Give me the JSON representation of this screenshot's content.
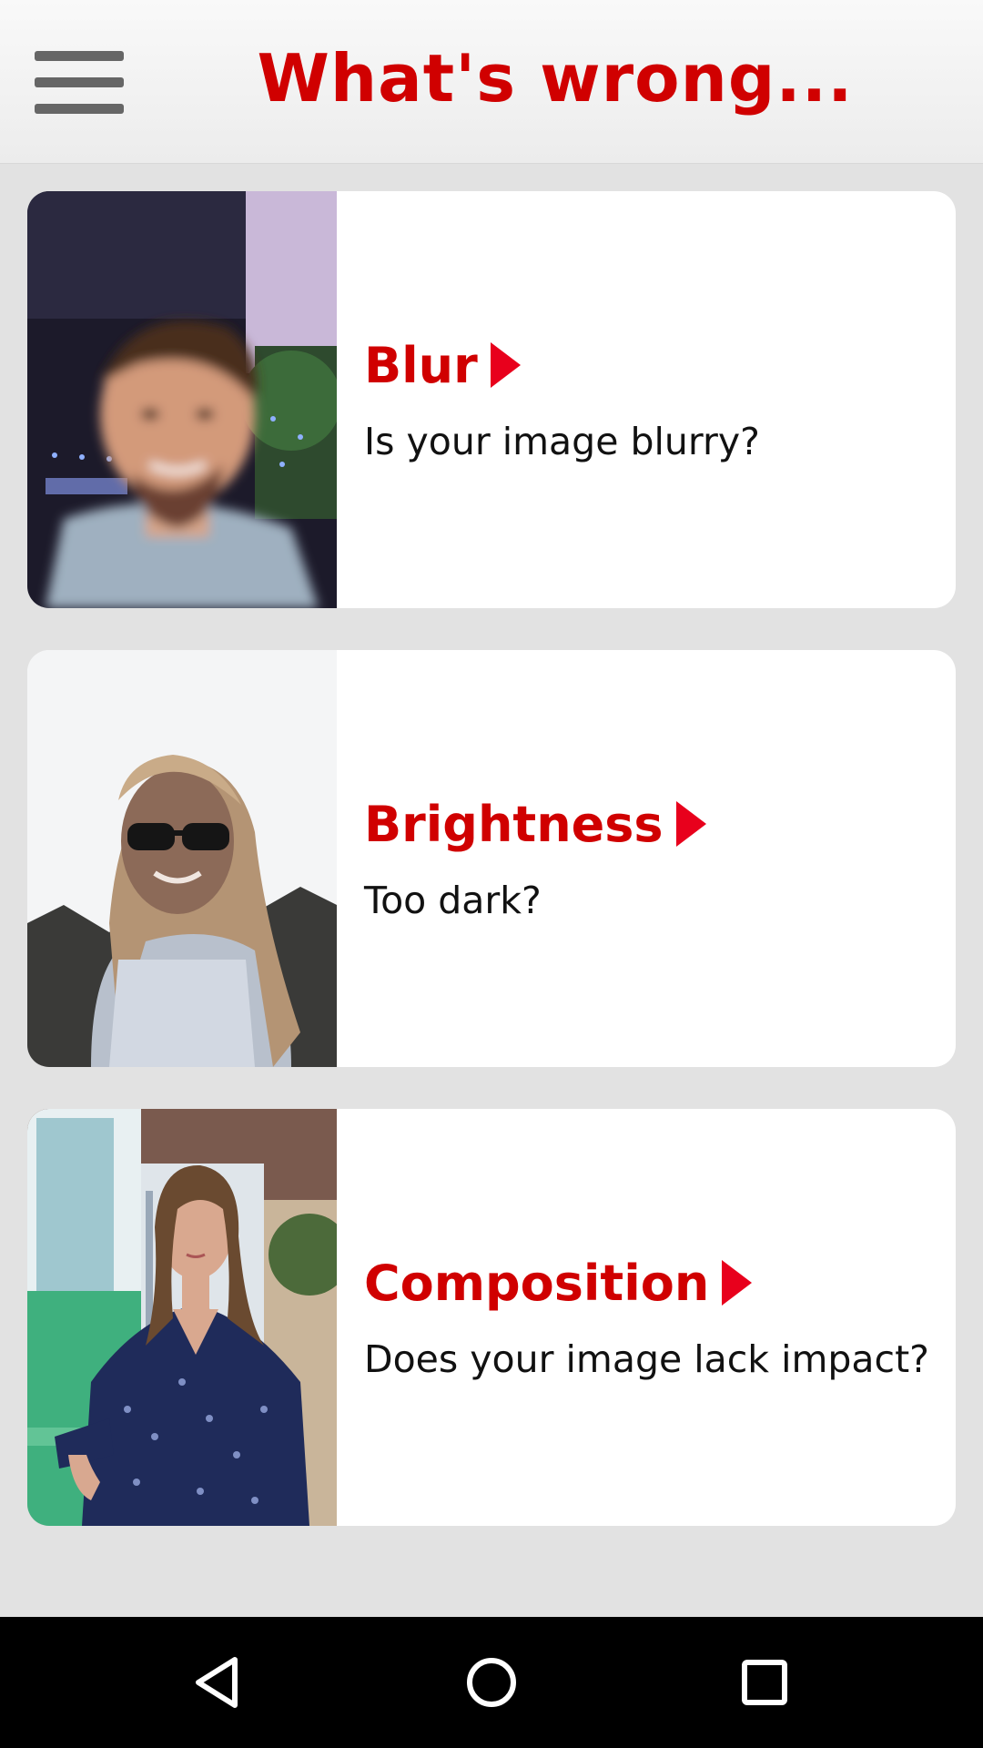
{
  "app_bar": {
    "title": "What's wrong...",
    "menu_icon": "hamburger-menu-icon"
  },
  "cards": [
    {
      "title": "Blur",
      "description": "Is your image blurry?",
      "image": "blurry-portrait-man",
      "arrow_icon": "play-arrow-icon"
    },
    {
      "title": "Brightness",
      "description": "Too dark?",
      "image": "backlit-portrait-woman-sunglasses",
      "arrow_icon": "play-arrow-icon"
    },
    {
      "title": "Composition",
      "description": "Does your image lack impact?",
      "image": "portrait-woman-beach-hut",
      "arrow_icon": "play-arrow-icon"
    }
  ],
  "nav_bar": {
    "back_icon": "back-triangle-icon",
    "home_icon": "home-circle-icon",
    "recents_icon": "recents-square-icon"
  },
  "colors": {
    "accent_red": "#d00000",
    "arrow_red": "#e8001c",
    "background": "#e2e2e2",
    "card": "#ffffff",
    "nav_bar": "#000000"
  }
}
